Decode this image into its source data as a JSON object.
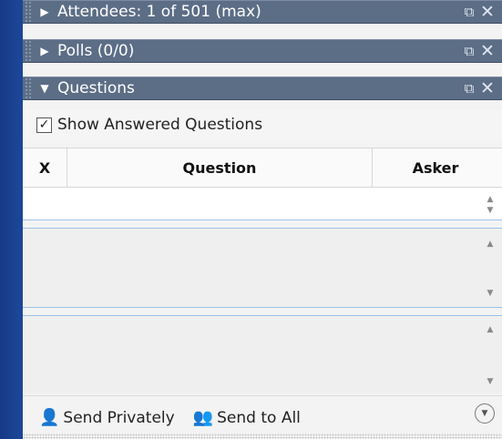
{
  "panes": [
    {
      "title": "Attendees: 1 of 501 (max)",
      "state": "collapsed"
    },
    {
      "title": "Polls (0/0)",
      "state": "collapsed"
    },
    {
      "title": "Questions",
      "state": "expanded"
    }
  ],
  "pane_controls": {
    "restore_icon": "restore-window-icon",
    "close_icon": "close-icon"
  },
  "questions": {
    "show_answered_label": "Show Answered Questions",
    "show_answered_checked": true,
    "columns": {
      "x": "X",
      "question": "Question",
      "asker": "Asker"
    }
  },
  "footer": {
    "send_privately_label": "Send Privately",
    "send_to_all_label": "Send to All",
    "options_icon": "chevron-down-circle-icon"
  },
  "colors": {
    "header": "#5c6d86",
    "frame": "#1c4597",
    "accent_line": "#9ec1e6"
  }
}
